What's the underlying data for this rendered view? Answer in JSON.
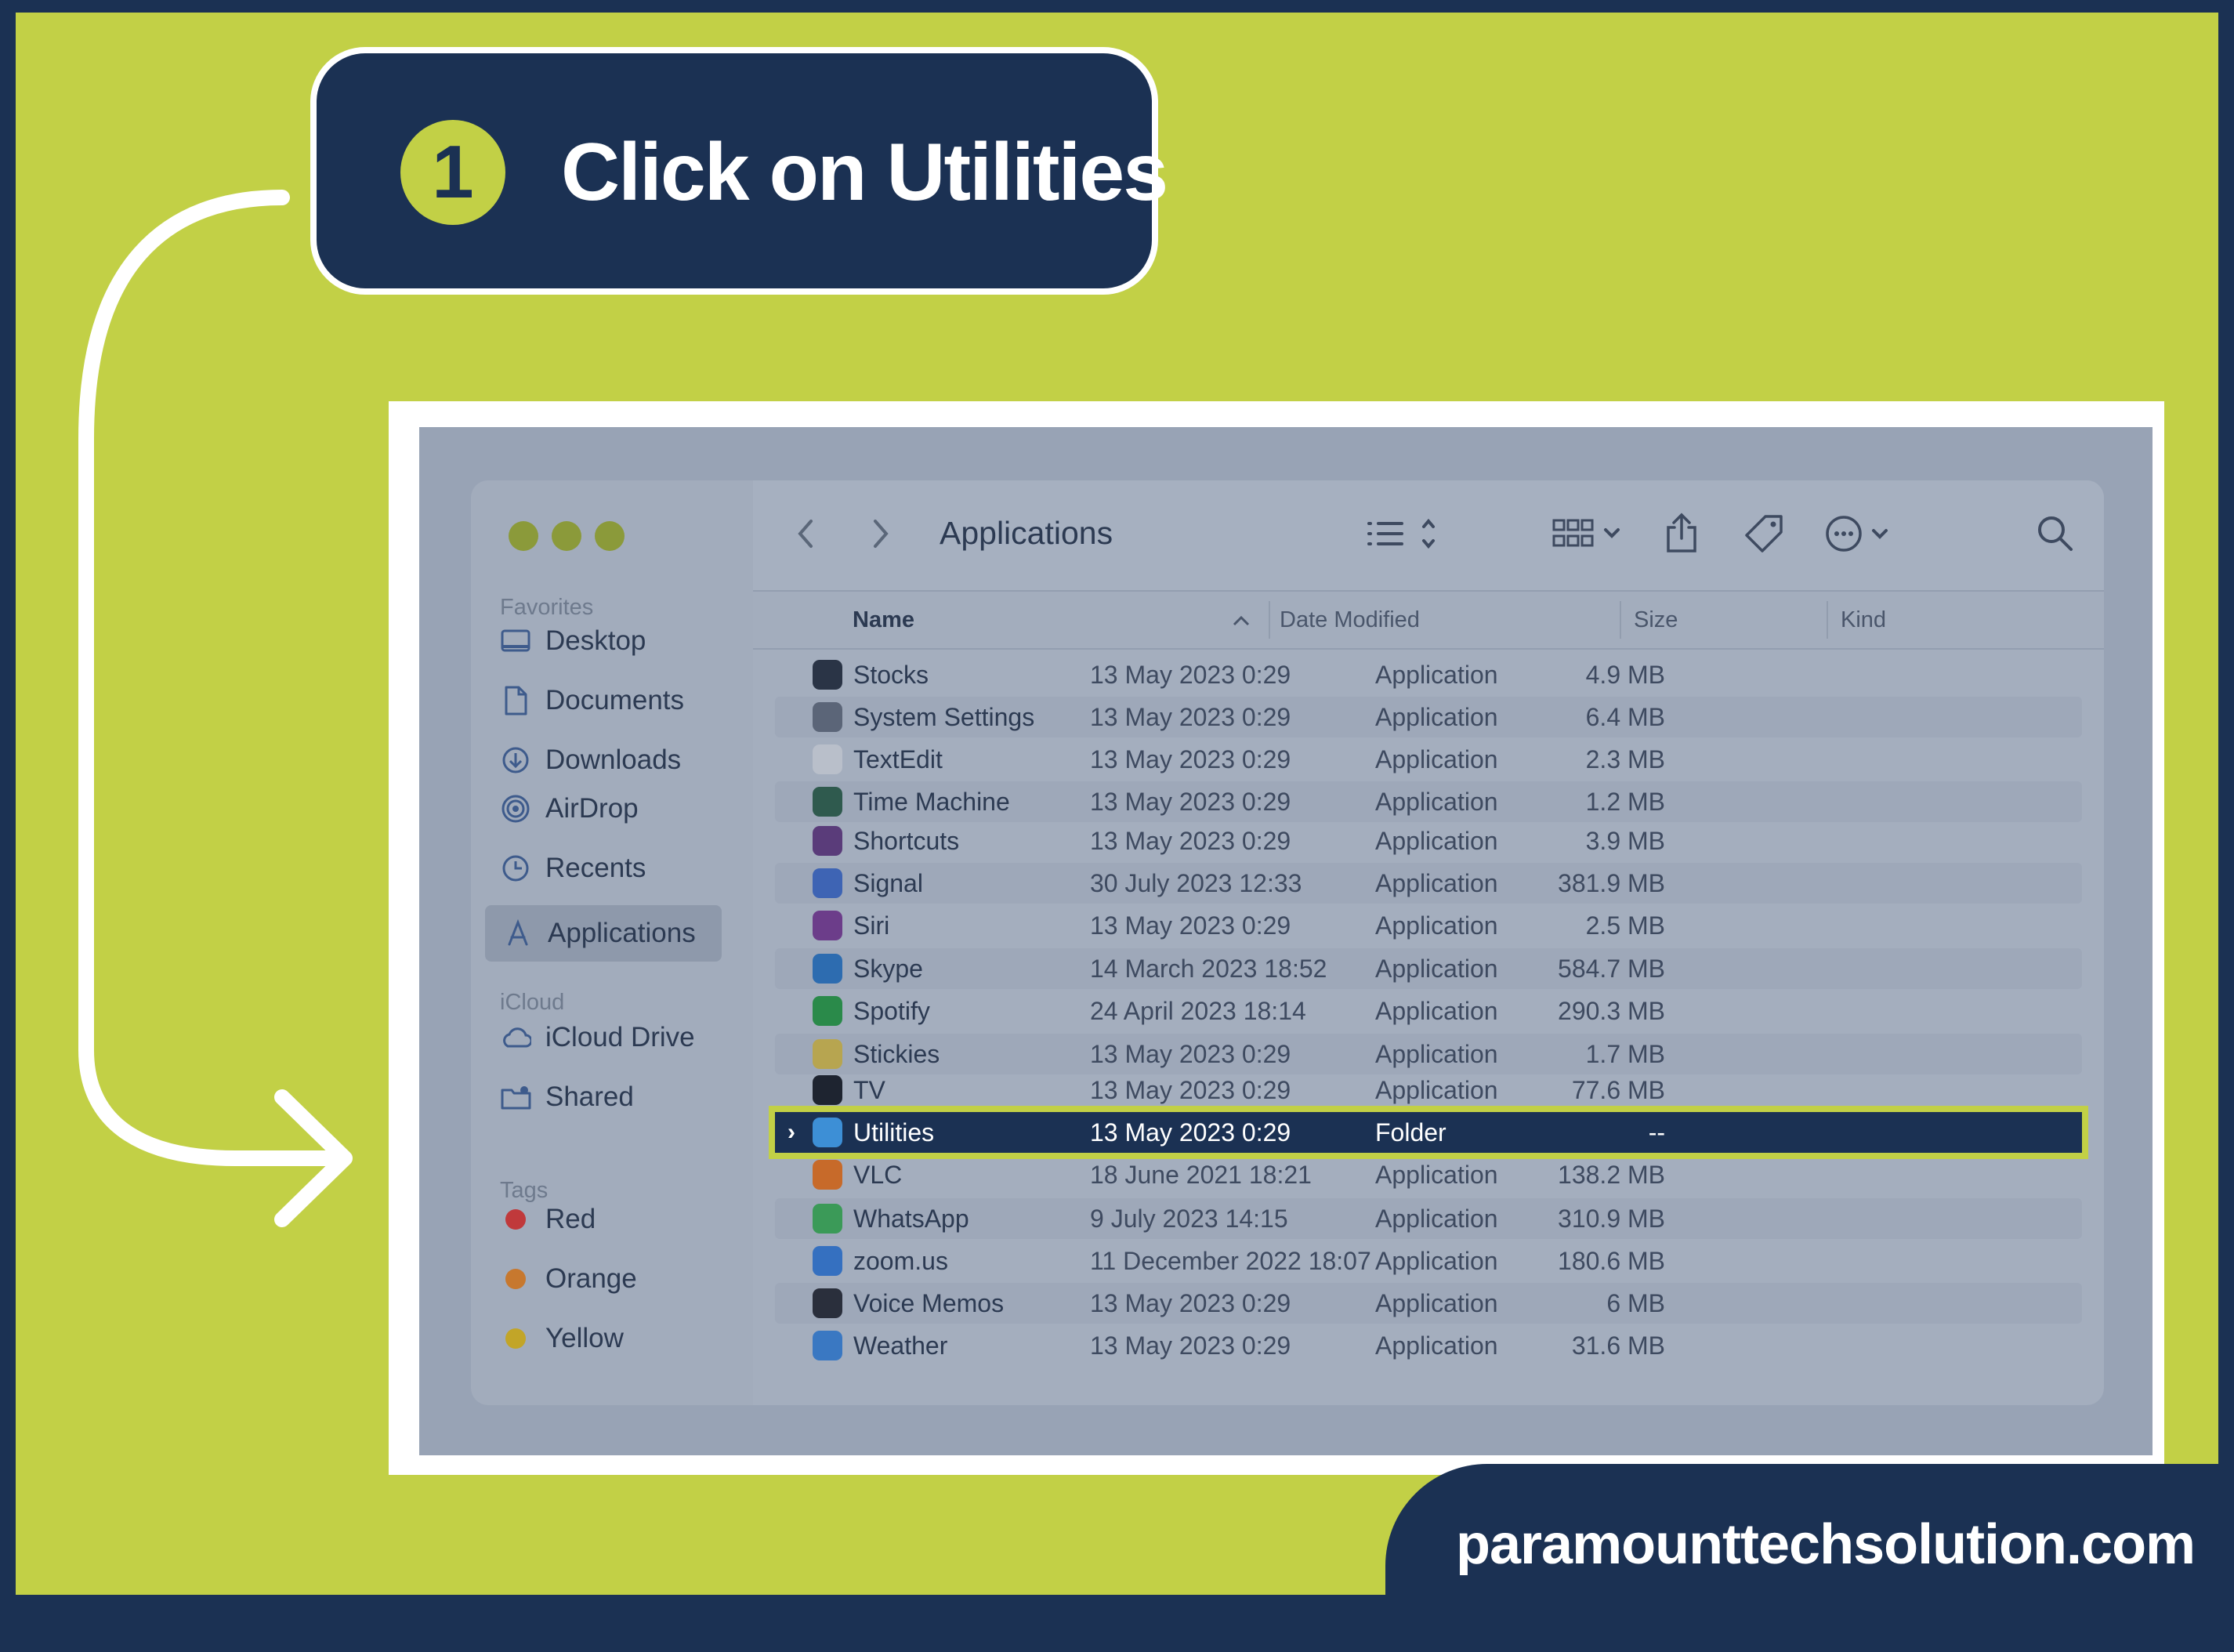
{
  "instruction": {
    "step_number": "1",
    "text": "Click on Utilities"
  },
  "finder": {
    "window_title": "Applications",
    "sidebar": {
      "favorites_heading": "Favorites",
      "favorites": [
        {
          "label": "Desktop",
          "icon": "desktop-icon"
        },
        {
          "label": "Documents",
          "icon": "document-icon"
        },
        {
          "label": "Downloads",
          "icon": "download-icon"
        },
        {
          "label": "AirDrop",
          "icon": "airdrop-icon"
        },
        {
          "label": "Recents",
          "icon": "clock-icon"
        },
        {
          "label": "Applications",
          "icon": "applications-icon",
          "selected": true
        }
      ],
      "icloud_heading": "iCloud",
      "icloud": [
        {
          "label": "iCloud Drive",
          "icon": "cloud-icon"
        },
        {
          "label": "Shared",
          "icon": "shared-folder-icon"
        }
      ],
      "tags_heading": "Tags",
      "tags": [
        {
          "label": "Red",
          "color": "#c0393b"
        },
        {
          "label": "Orange",
          "color": "#c7782e"
        },
        {
          "label": "Yellow",
          "color": "#c2a528"
        }
      ]
    },
    "columns": {
      "name": "Name",
      "date": "Date Modified",
      "size": "Size",
      "kind": "Kind"
    },
    "rows": [
      {
        "name": "Stocks",
        "date": "13 May 2023 0:29",
        "size": "4.9 MB",
        "kind": "Application",
        "icon_color": "#2a3446"
      },
      {
        "name": "System Settings",
        "date": "13 May 2023 0:29",
        "size": "6.4 MB",
        "kind": "Application",
        "icon_color": "#5b6578"
      },
      {
        "name": "TextEdit",
        "date": "13 May 2023 0:29",
        "size": "2.3 MB",
        "kind": "Application",
        "icon_color": "#b9bfca"
      },
      {
        "name": "Time Machine",
        "date": "13 May 2023 0:29",
        "size": "1.2 MB",
        "kind": "Application",
        "icon_color": "#2f5a4e"
      },
      {
        "name": "Shortcuts",
        "date": "13 May 2023 0:29",
        "size": "3.9 MB",
        "kind": "Application",
        "icon_color": "#5a3c7a"
      },
      {
        "name": "Signal",
        "date": "30 July 2023 12:33",
        "size": "381.9 MB",
        "kind": "Application",
        "icon_color": "#3e64b4"
      },
      {
        "name": "Siri",
        "date": "13 May 2023 0:29",
        "size": "2.5 MB",
        "kind": "Application",
        "icon_color": "#6c3d8a"
      },
      {
        "name": "Skype",
        "date": "14 March 2023 18:52",
        "size": "584.7 MB",
        "kind": "Application",
        "icon_color": "#2d6cb0"
      },
      {
        "name": "Spotify",
        "date": "24 April 2023 18:14",
        "size": "290.3 MB",
        "kind": "Application",
        "icon_color": "#2a8a4a"
      },
      {
        "name": "Stickies",
        "date": "13 May 2023 0:29",
        "size": "1.7 MB",
        "kind": "Application",
        "icon_color": "#b7a550"
      },
      {
        "name": "TV",
        "date": "13 May 2023 0:29",
        "size": "77.6 MB",
        "kind": "Application",
        "icon_color": "#1e2430"
      },
      {
        "name": "Utilities",
        "date": "13 May 2023 0:29",
        "size": "--",
        "kind": "Folder",
        "icon_color": "#3d8fd6",
        "highlighted": true
      },
      {
        "name": "VLC",
        "date": "18 June 2021 18:21",
        "size": "138.2 MB",
        "kind": "Application",
        "icon_color": "#c76a2a"
      },
      {
        "name": "WhatsApp",
        "date": "9 July 2023 14:15",
        "size": "310.9 MB",
        "kind": "Application",
        "icon_color": "#3b9a58"
      },
      {
        "name": "zoom.us",
        "date": "11 December 2022 18:07",
        "size": "180.6 MB",
        "kind": "Application",
        "icon_color": "#3570c0"
      },
      {
        "name": "Voice Memos",
        "date": "13 May 2023 0:29",
        "size": "6 MB",
        "kind": "Application",
        "icon_color": "#2a2f3c"
      },
      {
        "name": "Weather",
        "date": "13 May 2023 0:29",
        "size": "31.6 MB",
        "kind": "Application",
        "icon_color": "#3a78c2"
      }
    ]
  },
  "website": "paramounttechsolution.com",
  "colors": {
    "brand_navy": "#1b3153",
    "brand_lime": "#c2d046"
  }
}
